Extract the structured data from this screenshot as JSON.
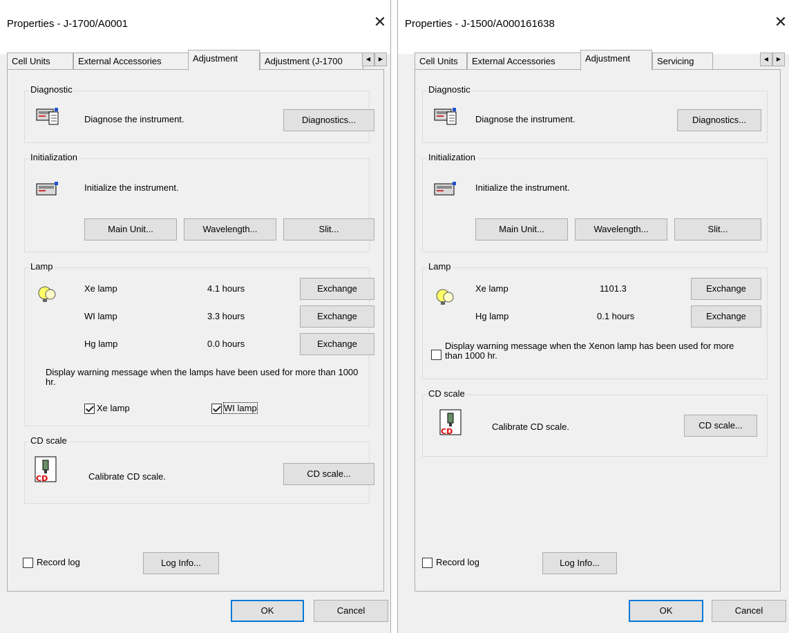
{
  "dialog1": {
    "title": "Properties - J-1700/A0001",
    "tabs": [
      "Cell Units",
      "External Accessories",
      "Adjustment",
      "Adjustment (J-1700"
    ],
    "diagnostic": {
      "title": "Diagnostic",
      "text": "Diagnose the instrument.",
      "button": "Diagnostics..."
    },
    "initialization": {
      "title": "Initialization",
      "text": "Initialize the instrument.",
      "buttons": [
        "Main Unit...",
        "Wavelength...",
        "Slit..."
      ]
    },
    "lamp": {
      "title": "Lamp",
      "rows": [
        {
          "name": "Xe lamp",
          "hours": "4.1 hours",
          "button": "Exchange"
        },
        {
          "name": "WI lamp",
          "hours": "3.3 hours",
          "button": "Exchange"
        },
        {
          "name": "Hg lamp",
          "hours": "0.0 hours",
          "button": "Exchange"
        }
      ],
      "warning": "Display warning message when the lamps have been used for more than 1000 hr.",
      "check_xe": "Xe lamp",
      "check_wi": "WI lamp"
    },
    "cdscale": {
      "title": "CD scale",
      "text": "Calibrate CD scale.",
      "button": "CD scale..."
    },
    "record_log": "Record log",
    "log_info": "Log Info...",
    "ok": "OK",
    "cancel": "Cancel"
  },
  "dialog2": {
    "title": "Properties - J-1500/A000161638",
    "tabs": [
      "Cell Units",
      "External Accessories",
      "Adjustment",
      "Servicing"
    ],
    "diagnostic": {
      "title": "Diagnostic",
      "text": "Diagnose the instrument.",
      "button": "Diagnostics..."
    },
    "initialization": {
      "title": "Initialization",
      "text": "Initialize the instrument.",
      "buttons": [
        "Main Unit...",
        "Wavelength...",
        "Slit..."
      ]
    },
    "lamp": {
      "title": "Lamp",
      "rows": [
        {
          "name": "Xe lamp",
          "hours": "1101.3",
          "button": "Exchange"
        },
        {
          "name": "Hg lamp",
          "hours": "0.1 hours",
          "button": "Exchange"
        }
      ],
      "warning": "Display warning message when the Xenon lamp has been used for more than 1000 hr."
    },
    "cdscale": {
      "title": "CD scale",
      "text": "Calibrate CD scale.",
      "button": "CD scale..."
    },
    "record_log": "Record log",
    "log_info": "Log Info...",
    "ok": "OK",
    "cancel": "Cancel"
  },
  "icons": {
    "close": "close-icon",
    "instrument": "instrument-icon",
    "lamp": "lamp-bulbs-icon",
    "cd": "cd-scale-icon"
  },
  "colors": {
    "accent": "#0078d7",
    "window": "#f0f0f0",
    "button": "#e1e1e1"
  }
}
